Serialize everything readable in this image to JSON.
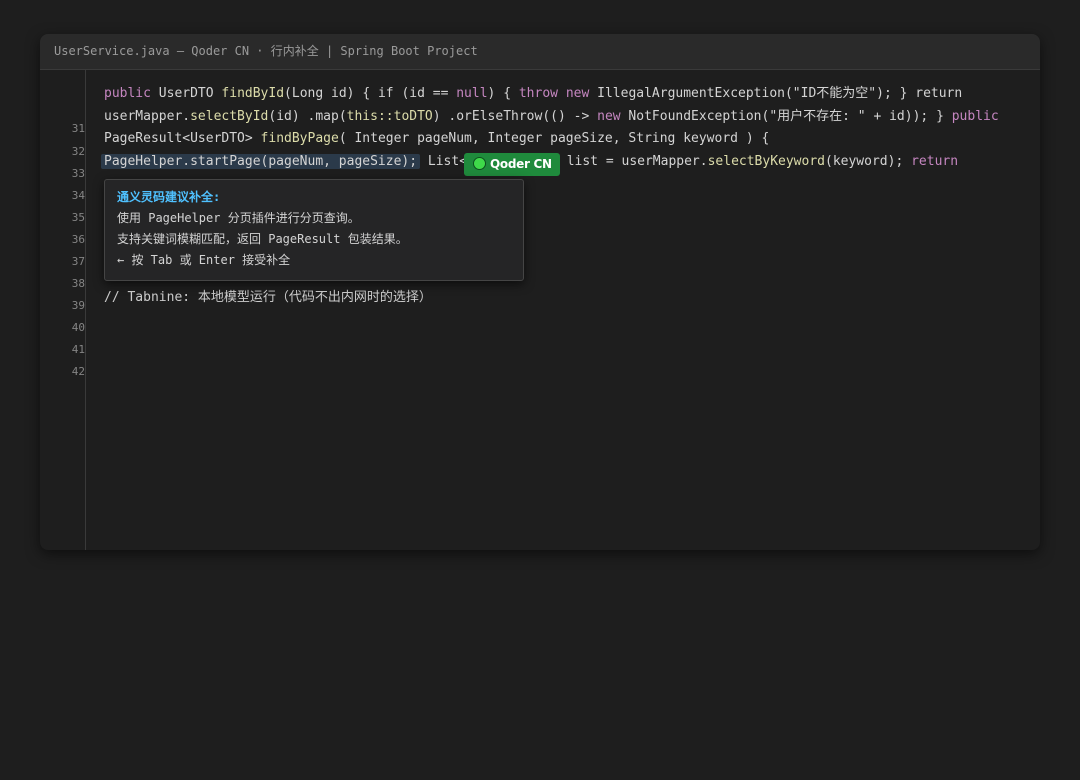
{
  "window": {
    "title": "UserService.java — Qoder CN · 行内补全 | Spring Boot Project"
  },
  "gutter": {
    "line_numbers": [
      "31",
      "32",
      "33",
      "34",
      "35",
      "36",
      "37",
      "38",
      "39",
      "40",
      "41",
      "42"
    ]
  },
  "code": {
    "line1": {
      "public": "public",
      "type": " UserDTO ",
      "fn": "findById",
      "a": "(Long id) { if (id == ",
      "null": "null",
      "b": ") { ",
      "throw": "throw",
      "sp": " ",
      "new": "new",
      "c": " IllegalArgumentException(\"ID不能为空\"); } return"
    },
    "line2": {
      "a": "userMapper.",
      "fn": "selectById",
      "b": "(id) .map(",
      "ref": "this::toDTO",
      "c": ") .orElseThrow(() -> ",
      "new": "new",
      "d": " NotFoundException(\"用户不存在: \" + id)); } ",
      "public": "public"
    },
    "line3": {
      "a": "PageResult<UserDTO> ",
      "fn": "findByPage",
      "b": "( Integer pageNum, Integer pageSize, String keyword ) {"
    },
    "line4": {
      "highlight": "PageHelper.startPage(pageNum, pageSize);",
      "a": " List<Us",
      "b": "list = userMapper.",
      "fn": "selectByKeyword",
      "c": "(keyword); ",
      "return": "return"
    },
    "line5": {
      "comment": "// Tabnine: 本地模型运行（代码不出内网时的选择）"
    }
  },
  "badge": {
    "label": "Qoder CN"
  },
  "suggestion": {
    "title": "通义灵码建议补全:",
    "line1": "使用 PageHelper 分页插件进行分页查询。",
    "line2": "支持关键词模糊匹配，返回 PageResult 包装结果。",
    "line3": "← 按 Tab 或 Enter 接受补全"
  },
  "colors": {
    "background": "#1e1e1e",
    "keyword": "#c586c0",
    "function": "#dcdcaa",
    "badge": "#1f8a3c",
    "popup_title": "#4fc1ff"
  }
}
